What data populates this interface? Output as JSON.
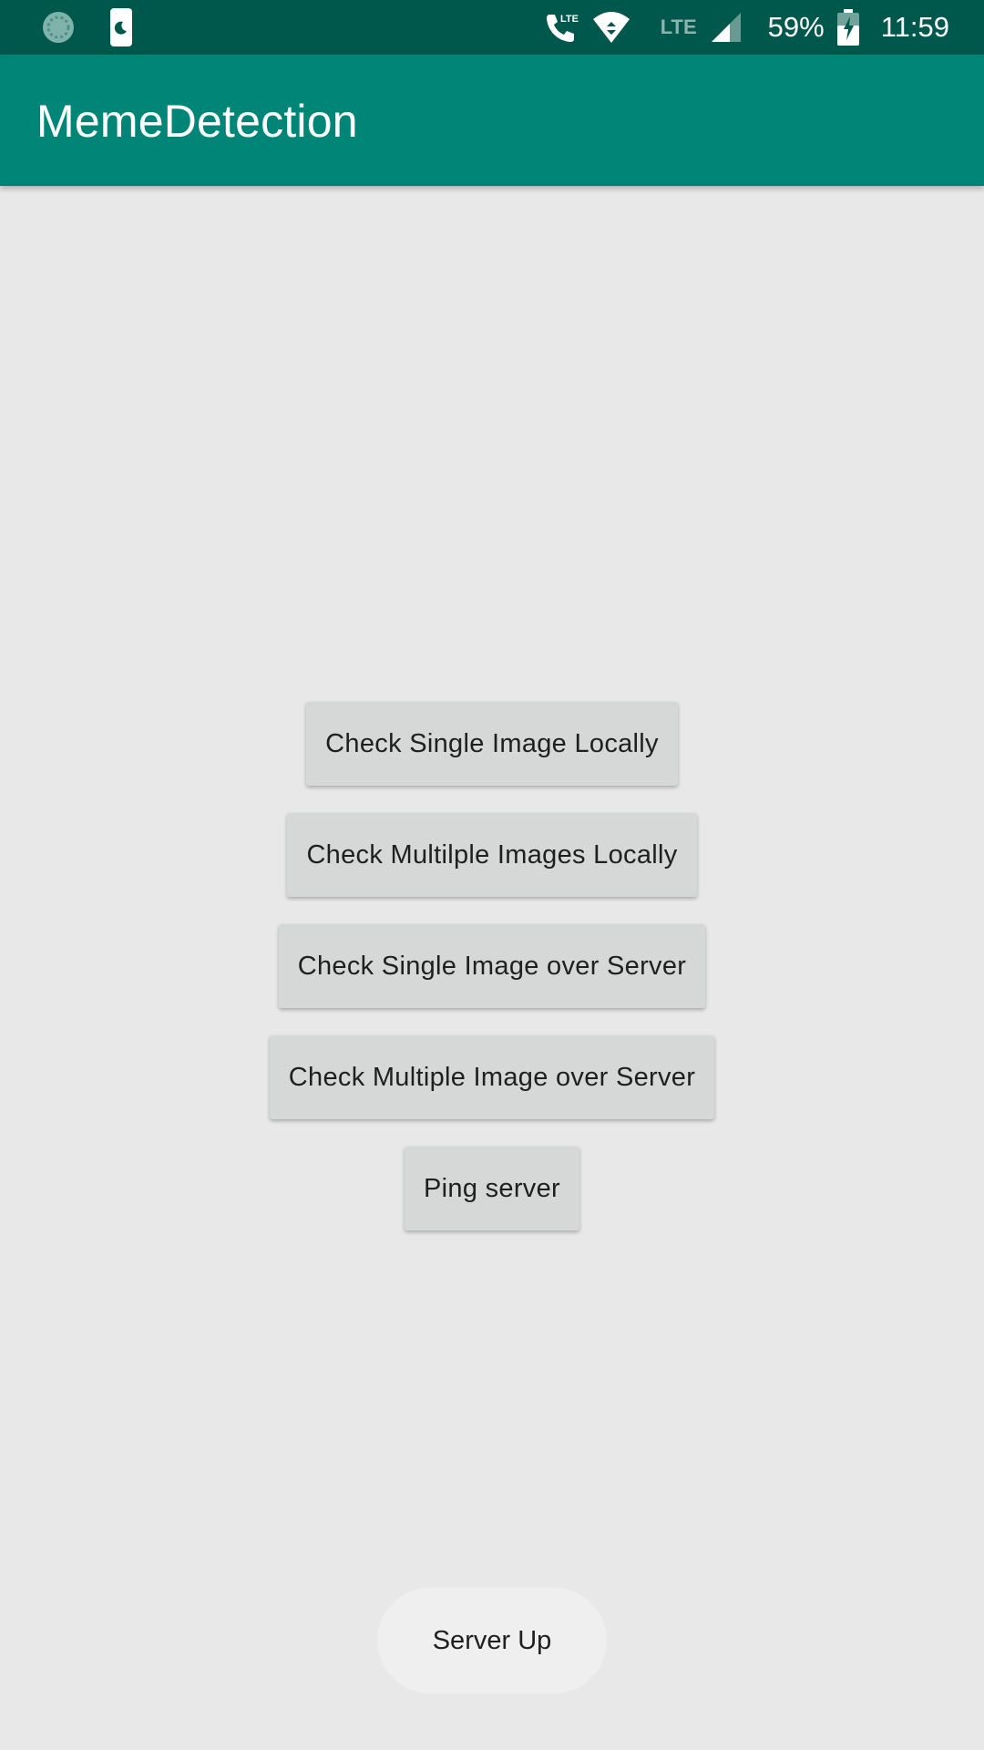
{
  "status_bar": {
    "left_icons": [
      "data-saver-icon",
      "do-not-disturb-icon"
    ],
    "right_icons": [
      "volte-call-icon",
      "wifi-icon",
      "cell-signal-icon",
      "battery-charging-icon"
    ],
    "lte_label": "LTE",
    "battery_percent": "59%",
    "time": "11:59"
  },
  "app_bar": {
    "title": "MemeDetection",
    "color": "#008577",
    "status_color": "#00574b"
  },
  "buttons": {
    "check_single_local": "Check Single Image Locally",
    "check_multiple_local": "Check Multilple Images Locally",
    "check_single_server": "Check Single Image over Server",
    "check_multiple_server": "Check Multiple Image over Server",
    "ping_server": "Ping server"
  },
  "toast": {
    "message": "Server Up"
  }
}
